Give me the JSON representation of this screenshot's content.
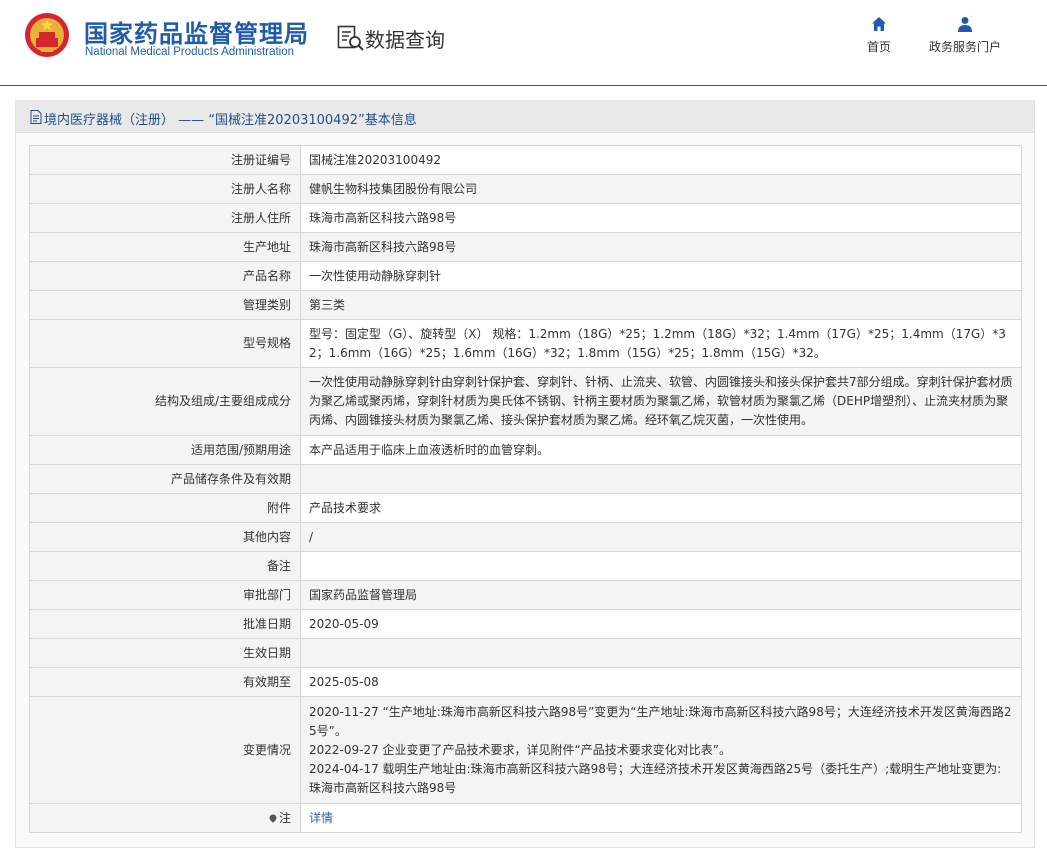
{
  "header": {
    "brand_cn": "国家药品监督管理局",
    "brand_en": "National Medical Products Administration",
    "section_title": "数据查询",
    "nav": {
      "home": "首页",
      "portal": "政务服务门户"
    }
  },
  "panel": {
    "title": "境内医疗器械（注册） —— “国械注准20203100492”基本信息"
  },
  "rows": [
    {
      "label": "注册证编号",
      "value": "国械注准20203100492"
    },
    {
      "label": "注册人名称",
      "value": "健帆生物科技集团股份有限公司"
    },
    {
      "label": "注册人住所",
      "value": "珠海市高新区科技六路98号"
    },
    {
      "label": "生产地址",
      "value": "珠海市高新区科技六路98号"
    },
    {
      "label": "产品名称",
      "value": "一次性使用动静脉穿刺针"
    },
    {
      "label": "管理类别",
      "value": "第三类"
    },
    {
      "label": "型号规格",
      "value": "型号：固定型（G）、旋转型（X） 规格：1.2mm（18G）*25；1.2mm（18G）*32；1.4mm（17G）*25；1.4mm（17G）*32；1.6mm（16G）*25；1.6mm（16G）*32；1.8mm（15G）*25；1.8mm（15G）*32。"
    },
    {
      "label": "结构及组成/主要组成成分",
      "value": "一次性使用动静脉穿刺针由穿刺针保护套、穿刺针、针柄、止流夹、软管、内圆锥接头和接头保护套共7部分组成。穿刺针保护套材质为聚乙烯或聚丙烯，穿刺针材质为奥氏体不锈钢、针柄主要材质为聚氯乙烯，软管材质为聚氯乙烯（DEHP增塑剂）、止流夹材质为聚丙烯、内圆锥接头材质为聚氯乙烯、接头保护套材质为聚乙烯。经环氧乙烷灭菌，一次性使用。"
    },
    {
      "label": "适用范围/预期用途",
      "value": "本产品适用于临床上血液透析时的血管穿刺。"
    },
    {
      "label": "产品储存条件及有效期",
      "value": ""
    },
    {
      "label": "附件",
      "value": "产品技术要求"
    },
    {
      "label": "其他内容",
      "value": "/"
    },
    {
      "label": "备注",
      "value": ""
    },
    {
      "label": "审批部门",
      "value": "国家药品监督管理局"
    },
    {
      "label": "批准日期",
      "value": "2020-05-09"
    },
    {
      "label": "生效日期",
      "value": ""
    },
    {
      "label": "有效期至",
      "value": "2025-05-08"
    }
  ],
  "changes": {
    "label": "变更情况",
    "lines": [
      "2020-11-27 “生产地址:珠海市高新区科技六路98号”变更为“生产地址:珠海市高新区科技六路98号；大连经济技术开发区黄海西路25号”。",
      "2022-09-27 企业变更了产品技术要求，详见附件“产品技术要求变化对比表”。",
      "2024-04-17 载明生产地址由:珠海市高新区科技六路98号；大连经济技术开发区黄海西路25号（委托生产）;载明生产地址变更为:珠海市高新区科技六路98号"
    ]
  },
  "note": {
    "label": "注",
    "link": "详情"
  }
}
